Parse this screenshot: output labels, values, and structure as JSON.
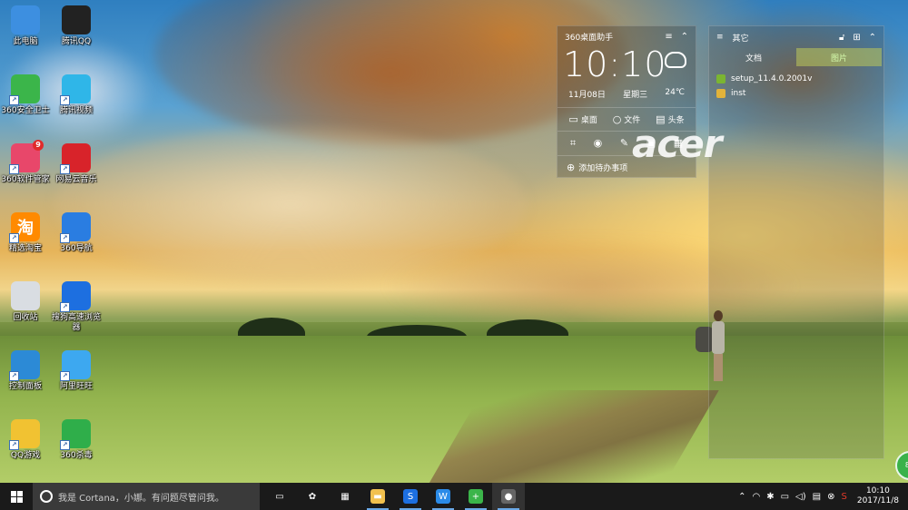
{
  "desktop_icons": [
    {
      "label": "此电脑",
      "icon": "computer-icon",
      "color": "#3d8fe0"
    },
    {
      "label": "腾讯QQ",
      "icon": "qq-penguin-icon",
      "color": "#222222"
    },
    {
      "label": "360安全卫士",
      "icon": "360-security-icon",
      "color": "#3bb54a"
    },
    {
      "label": "腾讯视频",
      "icon": "tencent-video-icon",
      "color": "#2fb6e8"
    },
    {
      "label": "360软件管家",
      "icon": "360-software-icon",
      "color": "#e8476a",
      "badge": "9"
    },
    {
      "label": "网易云音乐",
      "icon": "netease-music-icon",
      "color": "#d8232a"
    },
    {
      "label": "精选淘宝",
      "icon": "taobao-icon",
      "color": "#ff8a00",
      "glyph": "淘"
    },
    {
      "label": "360导航",
      "icon": "ie-browser-icon",
      "color": "#2a7de1"
    },
    {
      "label": "回收站",
      "icon": "recycle-bin-icon",
      "color": "#d9dde2"
    },
    {
      "label": "搜狗高速浏览器",
      "icon": "sogou-browser-icon",
      "color": "#1d6fe0"
    },
    {
      "label": "控制面板",
      "icon": "control-panel-icon",
      "color": "#2c8ad6"
    },
    {
      "label": "阿里旺旺",
      "icon": "aliwangwang-icon",
      "color": "#3da8f0"
    },
    {
      "label": "QQ游戏",
      "icon": "qq-game-icon",
      "color": "#f1c232"
    },
    {
      "label": "360杀毒",
      "icon": "360-antivirus-icon",
      "color": "#2fae4a"
    }
  ],
  "clock_widget": {
    "title": "360桌面助手",
    "time": "10:10",
    "date": "11月08日",
    "weekday": "星期三",
    "temperature": "24℃",
    "tools": [
      {
        "label": "桌面",
        "icon": "monitor-icon"
      },
      {
        "label": "文件",
        "icon": "search-icon"
      },
      {
        "label": "头条",
        "icon": "news-icon"
      }
    ],
    "quick_icons": [
      "crop-icon",
      "eye-icon",
      "edit-icon",
      "window-icon",
      "grid-icon"
    ],
    "todo_label": "添加待办事项"
  },
  "other_widget": {
    "title": "其它",
    "tabs": [
      "文档",
      "图片"
    ],
    "active_tab": 1,
    "files": [
      {
        "name": "setup_11.4.0.2001v",
        "color": "#7bb531"
      },
      {
        "name": "inst",
        "color": "#e2b33a"
      }
    ]
  },
  "brand": "acer",
  "float_ball_label": "80",
  "taskbar": {
    "search_placeholder": "我是 Cortana，小娜。有问题尽管问我。",
    "apps": [
      {
        "name": "task-view",
        "icon": "task-view-icon",
        "glyph": "▭",
        "color": "#1a1a1a"
      },
      {
        "name": "fan-app",
        "icon": "fan-icon",
        "glyph": "✿",
        "color": "#1a1a1a"
      },
      {
        "name": "store",
        "icon": "store-icon",
        "glyph": "▦",
        "color": "#1a1a1a"
      },
      {
        "name": "explorer",
        "icon": "folder-icon",
        "glyph": "▬",
        "color": "#f2c14e"
      },
      {
        "name": "sogou",
        "icon": "sogou-browser-icon",
        "glyph": "S",
        "color": "#1d6fe0"
      },
      {
        "name": "wps",
        "icon": "wps-icon",
        "glyph": "W",
        "color": "#2b8be8"
      },
      {
        "name": "360-security",
        "icon": "360-security-icon",
        "glyph": "+",
        "color": "#3bb54a"
      },
      {
        "name": "photo",
        "icon": "photo-icon",
        "glyph": "●",
        "color": "#666666"
      }
    ],
    "tray_icons": [
      "chevron-up-icon",
      "network-icon",
      "bug-icon",
      "battery-icon",
      "volume-icon",
      "message-icon",
      "close-circle-icon",
      "sogou-ime-icon"
    ],
    "time": "10:10",
    "date": "2017/11/8"
  }
}
